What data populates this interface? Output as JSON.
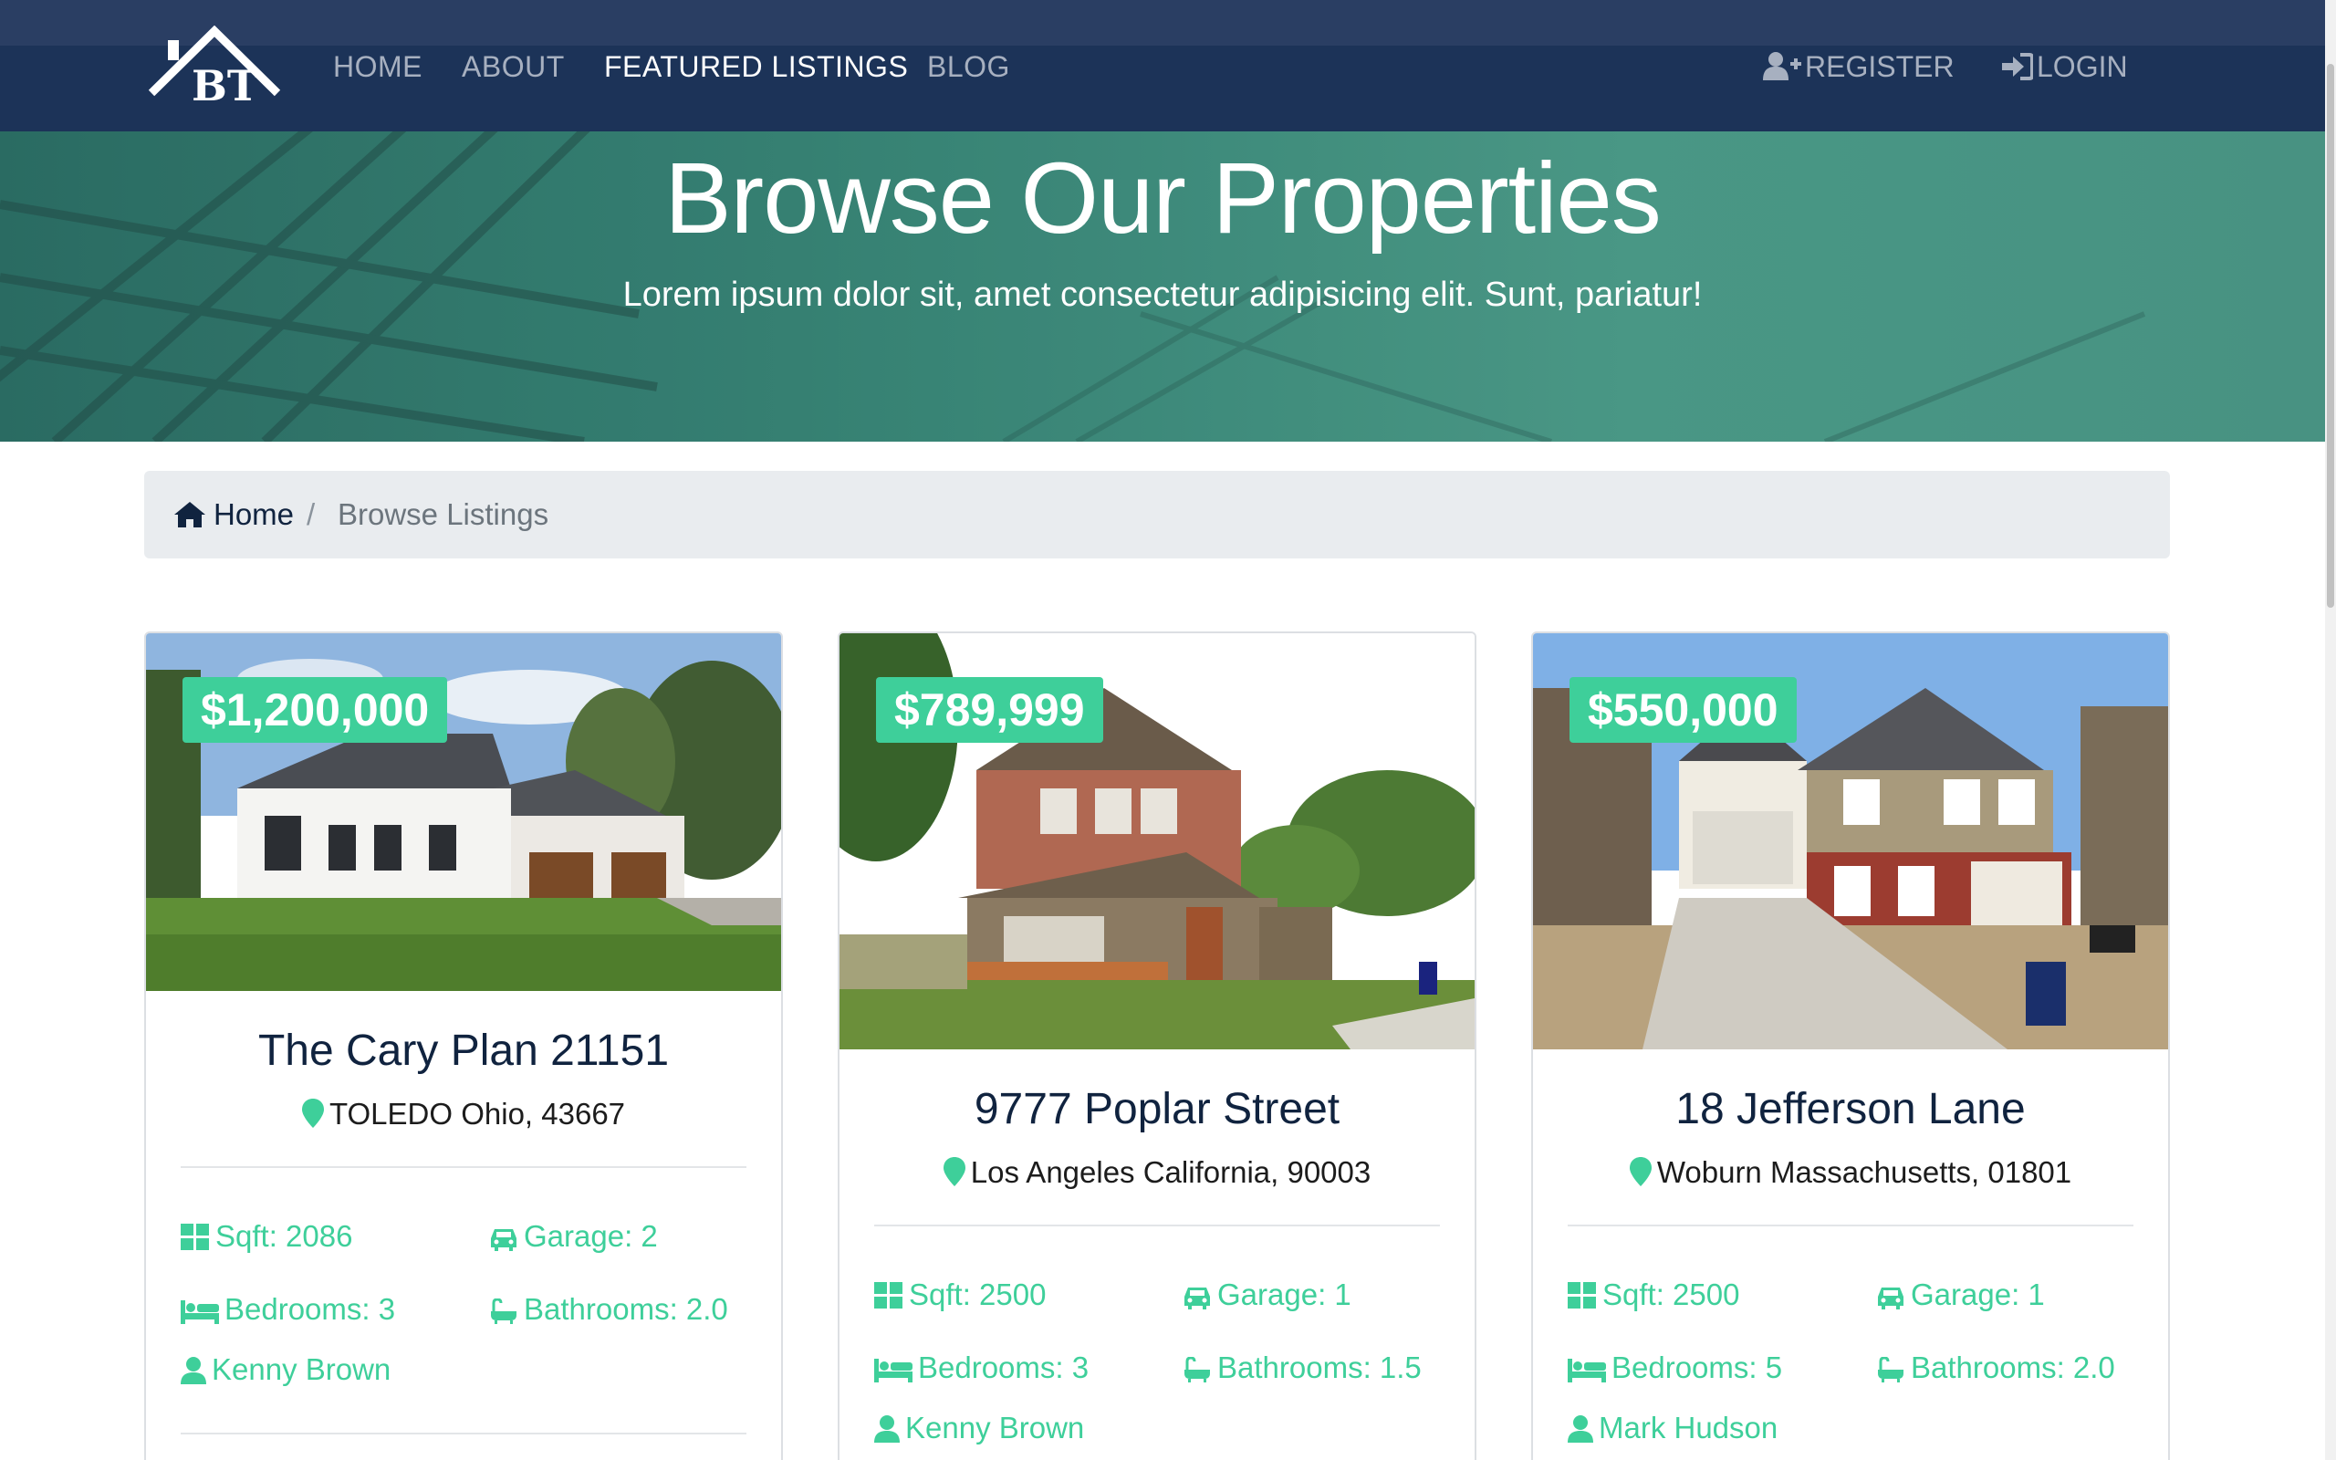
{
  "nav": {
    "brand_text": "BT",
    "links": [
      {
        "label": "HOME",
        "active": false
      },
      {
        "label": "ABOUT",
        "active": false
      },
      {
        "label": "FEATURED LISTINGS",
        "active": true
      },
      {
        "label": "BLOG",
        "active": false
      }
    ],
    "register_label": "REGISTER",
    "login_label": "LOGIN"
  },
  "hero": {
    "title": "Browse Our Properties",
    "subtitle": "Lorem ipsum dolor sit, amet consectetur adipisicing elit. Sunt, pariatur!"
  },
  "breadcrumb": {
    "home_label": "Home",
    "separator": "/",
    "current_label": "Browse Listings"
  },
  "listings": [
    {
      "price": "$1,200,000",
      "title": "The Cary Plan 21151",
      "location": "TOLEDO Ohio, 43667",
      "sqft": "Sqft: 2086",
      "garage": "Garage: 2",
      "bedrooms": "Bedrooms: 3",
      "bathrooms": "Bathrooms: 2.0",
      "realtor": "Kenny Brown"
    },
    {
      "price": "$789,999",
      "title": "9777 Poplar Street",
      "location": "Los Angeles California, 90003",
      "sqft": "Sqft: 2500",
      "garage": "Garage: 1",
      "bedrooms": "Bedrooms: 3",
      "bathrooms": "Bathrooms: 1.5",
      "realtor": "Kenny Brown"
    },
    {
      "price": "$550,000",
      "title": "18 Jefferson Lane",
      "location": "Woburn Massachusetts, 01801",
      "sqft": "Sqft: 2500",
      "garage": "Garage: 1",
      "bedrooms": "Bedrooms: 5",
      "bathrooms": "Bathrooms: 2.0",
      "realtor": "Mark Hudson"
    }
  ],
  "colors": {
    "navbar": "#1c3358",
    "accent": "#3ecf9a",
    "hero": "#3b8a78",
    "title_text": "#10233f"
  },
  "icons": [
    "user-plus-icon",
    "sign-in-icon",
    "home-icon",
    "map-marker-icon",
    "th-large-icon",
    "car-icon",
    "bed-icon",
    "bath-icon",
    "user-icon"
  ]
}
